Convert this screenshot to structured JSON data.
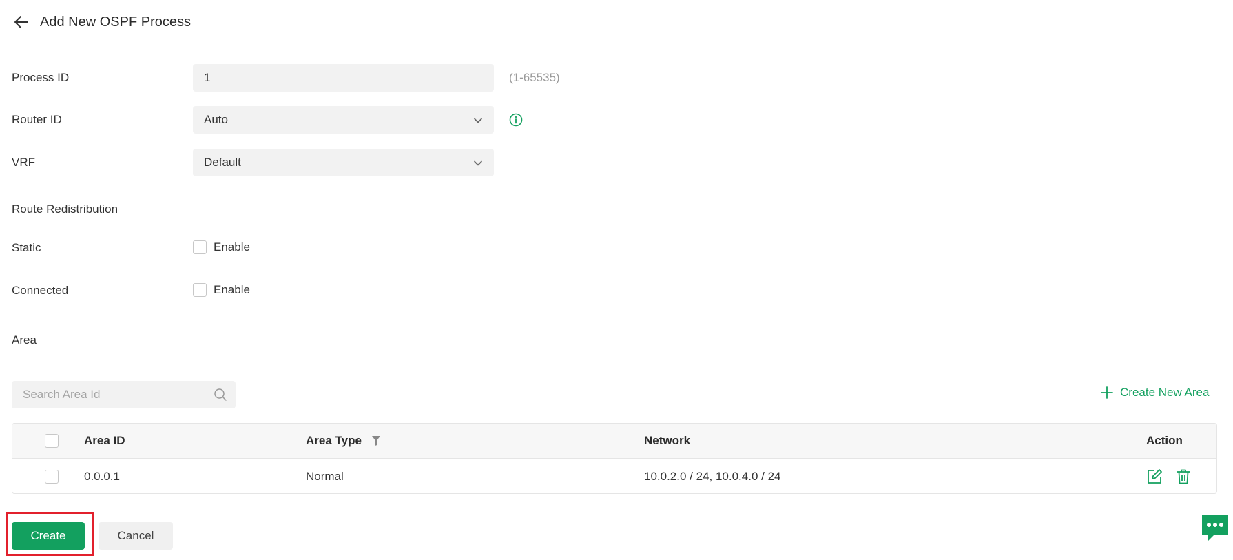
{
  "header": {
    "title": "Add New OSPF Process"
  },
  "form": {
    "process_id": {
      "label": "Process ID",
      "value": "1",
      "hint": "(1-65535)"
    },
    "router_id": {
      "label": "Router ID",
      "value": "Auto"
    },
    "vrf": {
      "label": "VRF",
      "value": "Default"
    }
  },
  "route_redistribution": {
    "title": "Route Redistribution",
    "static": {
      "label": "Static",
      "option_label": "Enable",
      "checked": false
    },
    "connected": {
      "label": "Connected",
      "option_label": "Enable",
      "checked": false
    }
  },
  "area": {
    "title": "Area",
    "search_placeholder": "Search Area Id",
    "create_new_label": "Create New Area",
    "columns": {
      "area_id": "Area ID",
      "area_type": "Area Type",
      "network": "Network",
      "action": "Action"
    },
    "rows": [
      {
        "area_id": "0.0.0.1",
        "area_type": "Normal",
        "network": "10.0.2.0 / 24, 10.0.4.0 / 24"
      }
    ]
  },
  "footer": {
    "create_label": "Create",
    "cancel_label": "Cancel"
  },
  "colors": {
    "accent": "#13a05f",
    "highlight": "#e2202c",
    "field_bg": "#f2f2f2"
  },
  "icons": [
    "arrow-left-icon",
    "chevron-down-icon",
    "info-icon",
    "search-icon",
    "plus-icon",
    "filter-icon",
    "edit-icon",
    "trash-icon",
    "chat-icon"
  ]
}
